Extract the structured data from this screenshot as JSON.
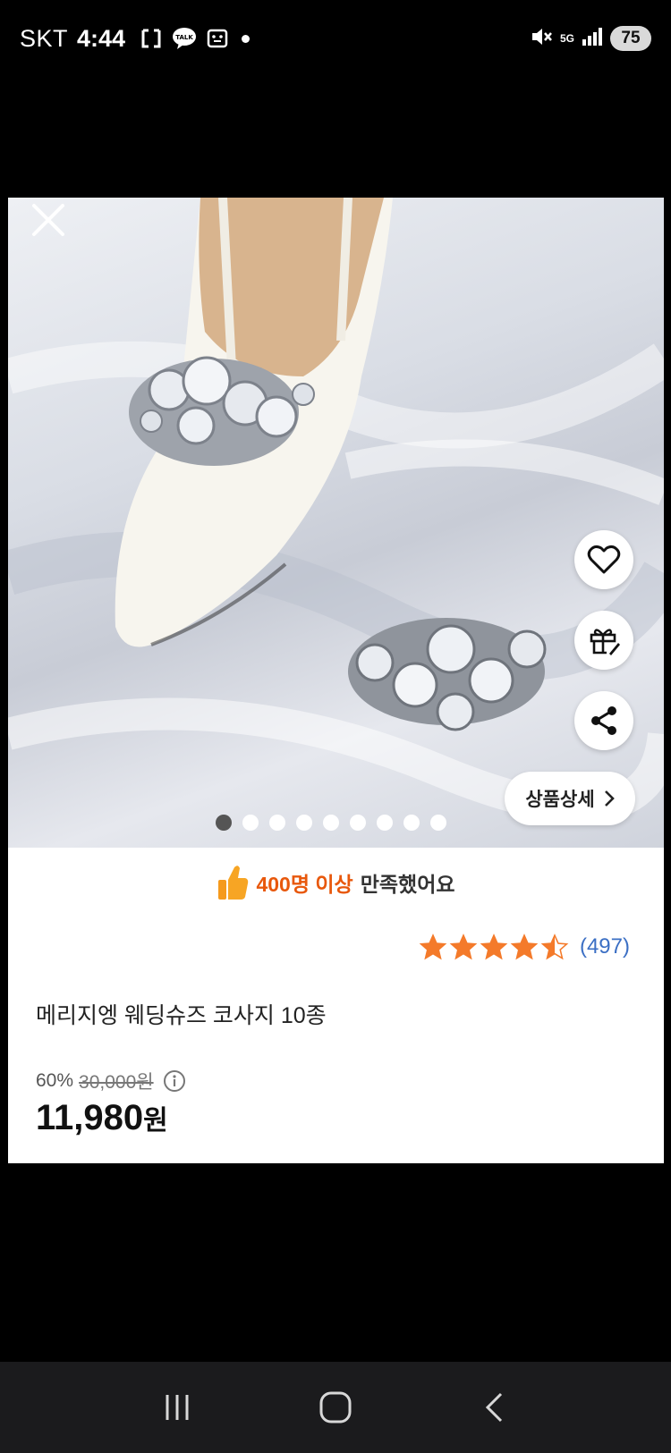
{
  "status_bar": {
    "carrier": "SKT",
    "time": "4:44",
    "network": "5G",
    "battery": "75"
  },
  "hero": {
    "dot_count": 9,
    "active_dot": 0,
    "detail_label": "상품상세"
  },
  "info": {
    "satisfaction_accent": "400명 이상",
    "satisfaction_rest": "만족했어요",
    "rating": 4.5,
    "review_count": "(497)",
    "title": "메리지엥 웨딩슈즈 코사지 10종",
    "discount": "60%",
    "original_price": "30,000원",
    "sale_price_number": "11,980",
    "sale_price_unit": "원"
  },
  "colors": {
    "accent": "#e8580c",
    "star": "#f47a2a",
    "link": "#3b6fc4"
  }
}
